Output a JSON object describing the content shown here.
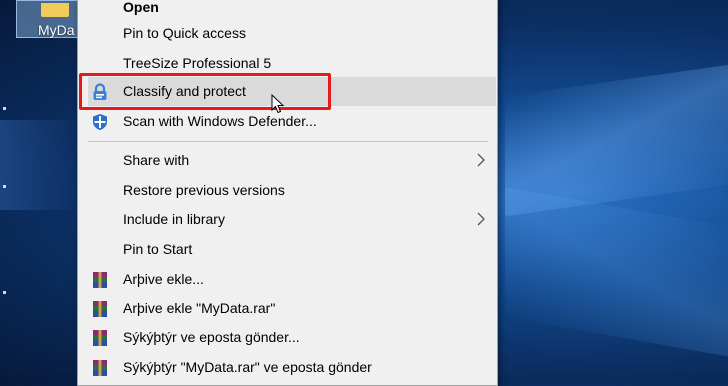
{
  "desktop": {
    "icon_label": "MyDa"
  },
  "menu": {
    "items": [
      {
        "label": "Open"
      },
      {
        "label": "Pin to Quick access"
      },
      {
        "label": "TreeSize Professional 5"
      },
      {
        "label": "Classify and protect",
        "icon": "lock-icon"
      },
      {
        "label": "Scan with Windows Defender...",
        "icon": "windows-defender-icon"
      },
      {
        "label": "Share with",
        "submenu": true
      },
      {
        "label": "Restore previous versions"
      },
      {
        "label": "Include in library",
        "submenu": true
      },
      {
        "label": "Pin to Start"
      },
      {
        "label": "Arþive ekle...",
        "icon": "winrar-icon"
      },
      {
        "label": "Arþive ekle \"MyData.rar\"",
        "icon": "winrar-icon"
      },
      {
        "label": "Sýkýþtýr ve eposta gönder...",
        "icon": "winrar-icon"
      },
      {
        "label": "Sýkýþtýr \"MyData.rar\" ve eposta gönder",
        "icon": "winrar-icon"
      }
    ]
  },
  "colors": {
    "highlight_border": "#e51a1a",
    "menu_background": "#f0f0f0",
    "hover_background": "#dadada"
  }
}
